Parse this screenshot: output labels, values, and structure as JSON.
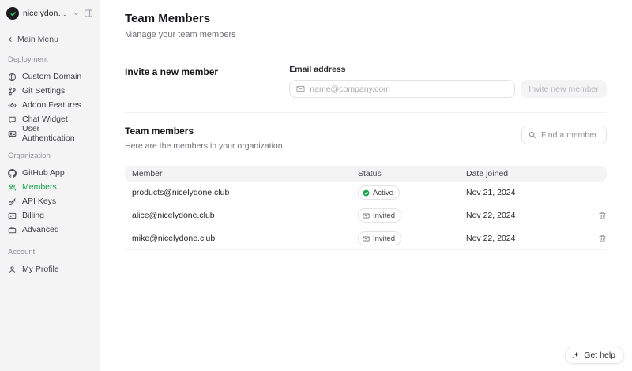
{
  "colors": {
    "accent": "#16a34a",
    "sidebar_bg": "#f4f4f5",
    "avatar_bg": "#1b1b1f",
    "avatar_accent": "#22c55e"
  },
  "workspace": {
    "name": "nicelydone-..."
  },
  "back_link": {
    "label": "Main Menu"
  },
  "sidebar": {
    "sections": [
      {
        "label": "Deployment",
        "items": [
          {
            "label": "Custom Domain",
            "icon": "globe-icon"
          },
          {
            "label": "Git Settings",
            "icon": "git-branch-icon"
          },
          {
            "label": "Addon Features",
            "icon": "addon-icon"
          },
          {
            "label": "Chat Widget",
            "icon": "chat-bubble-icon"
          },
          {
            "label": "User Authentication",
            "icon": "id-card-icon"
          }
        ]
      },
      {
        "label": "Organization",
        "items": [
          {
            "label": "GitHub App",
            "icon": "github-icon"
          },
          {
            "label": "Members",
            "icon": "users-icon",
            "active": true
          },
          {
            "label": "API Keys",
            "icon": "key-icon"
          },
          {
            "label": "Billing",
            "icon": "credit-card-icon"
          },
          {
            "label": "Advanced",
            "icon": "briefcase-icon"
          }
        ]
      },
      {
        "label": "Account",
        "items": [
          {
            "label": "My Profile",
            "icon": "user-icon"
          }
        ]
      }
    ]
  },
  "header": {
    "title": "Team Members",
    "subtitle": "Manage your team members"
  },
  "invite": {
    "section_title": "Invite a new member",
    "email_label": "Email address",
    "email_placeholder": "name@company.com",
    "button_label": "Invite new member",
    "button_state": "disabled"
  },
  "members": {
    "section_title": "Team members",
    "section_subtitle": "Here are the members in your organization",
    "search_placeholder": "Find a member",
    "columns": {
      "member": "Member",
      "status": "Status",
      "date": "Date joined"
    },
    "rows": [
      {
        "email": "products@nicelydone.club",
        "status": "Active",
        "date": "Nov 21, 2024",
        "deletable": false
      },
      {
        "email": "alice@nicelydone.club",
        "status": "Invited",
        "date": "Nov 22, 2024",
        "deletable": true
      },
      {
        "email": "mike@nicelydone.club",
        "status": "Invited",
        "date": "Nov 22, 2024",
        "deletable": true
      }
    ]
  },
  "help_button": {
    "label": "Get help"
  }
}
